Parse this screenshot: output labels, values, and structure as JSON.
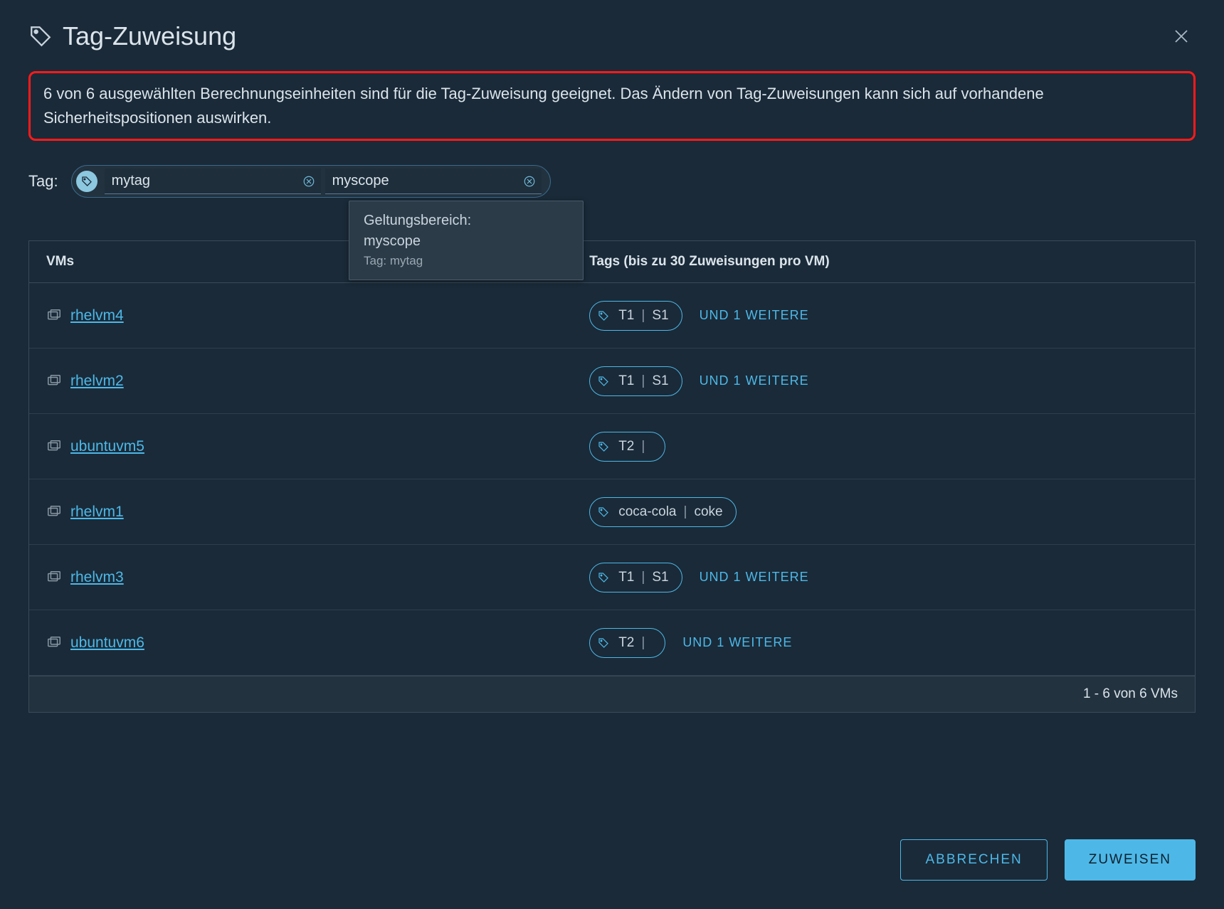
{
  "header": {
    "title": "Tag-Zuweisung"
  },
  "info_message": "6 von 6 ausgewählten Berechnungseinheiten sind für die Tag-Zuweisung geeignet. Das Ändern von Tag-Zuweisungen kann sich auf vorhandene Sicherheitspositionen auswirken.",
  "tag_input": {
    "label": "Tag:",
    "tag_value": "mytag",
    "scope_value": "myscope"
  },
  "tooltip": {
    "line1": "Geltungsbereich:",
    "line2": "myscope",
    "line3": "Tag: mytag"
  },
  "table": {
    "col_vm": "VMs",
    "col_tags": "Tags (bis zu 30 Zuweisungen pro VM)",
    "rows": [
      {
        "vm": "rhelvm4",
        "tag": "T1",
        "scope": "S1",
        "more": "UND 1 WEITERE"
      },
      {
        "vm": "rhelvm2",
        "tag": "T1",
        "scope": "S1",
        "more": "UND 1 WEITERE"
      },
      {
        "vm": "ubuntuvm5",
        "tag": "T2",
        "scope": "",
        "more": ""
      },
      {
        "vm": "rhelvm1",
        "tag": "coca-cola",
        "scope": "coke",
        "more": ""
      },
      {
        "vm": "rhelvm3",
        "tag": "T1",
        "scope": "S1",
        "more": "UND 1 WEITERE"
      },
      {
        "vm": "ubuntuvm6",
        "tag": "T2",
        "scope": "",
        "more": "UND 1 WEITERE"
      }
    ],
    "footer": "1 - 6 von 6 VMs"
  },
  "buttons": {
    "cancel": "ABBRECHEN",
    "assign": "ZUWEISEN"
  }
}
